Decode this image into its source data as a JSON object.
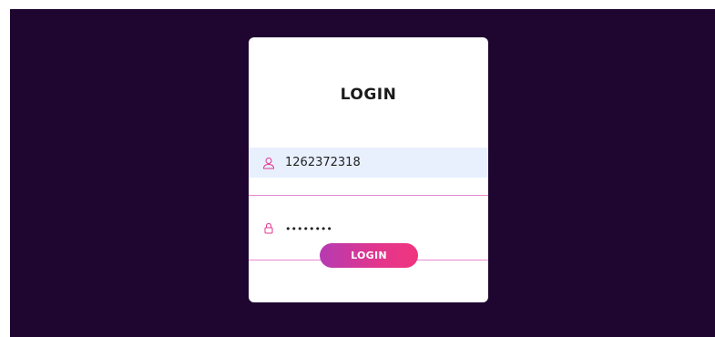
{
  "login_form": {
    "title": "LOGIN",
    "username_value": "1262372318",
    "password_value": "••••••••",
    "submit_label": "LOGIN"
  },
  "icons": {
    "username": "user-icon",
    "password": "lock-icon"
  },
  "colors": {
    "background": "#1f0631",
    "card": "#ffffff",
    "accent_pink": "#e0368e",
    "accent_purple": "#b53bb2",
    "autofill_bg": "#e8f0fe"
  }
}
